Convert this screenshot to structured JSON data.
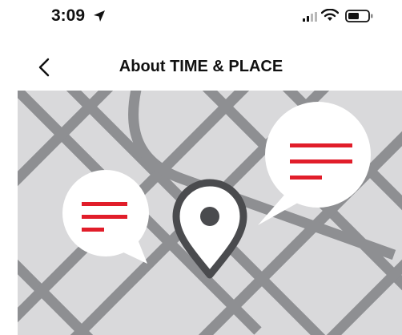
{
  "status_bar": {
    "time": "3:09",
    "icons": [
      "location-arrow-icon",
      "cellular-signal-icon",
      "wifi-icon",
      "battery-icon"
    ]
  },
  "nav": {
    "title": "About TIME & PLACE",
    "back_icon": "chevron-left-icon"
  },
  "illustration": {
    "description_icon": "map-with-pin-and-speech-bubbles",
    "colors": {
      "map_background": "#d9d9db",
      "roads": "#8e8f92",
      "pin": "#4a4b4e",
      "bubble": "#ffffff",
      "text_lines": "#e11d2a"
    }
  }
}
